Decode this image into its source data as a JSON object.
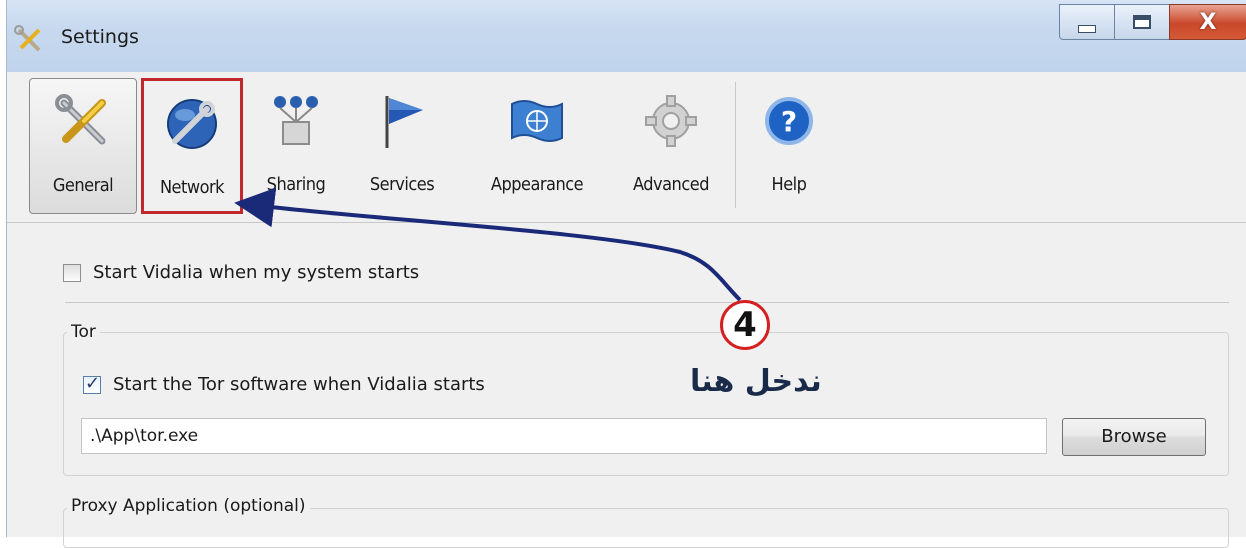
{
  "window": {
    "title": "Settings",
    "icon": "settings-tools-icon"
  },
  "caption_buttons": [
    "minimize-icon",
    "maximize-icon",
    "close-icon"
  ],
  "toolbar": {
    "items": [
      {
        "label": "General",
        "icon": "tools-icon",
        "selected": true
      },
      {
        "label": "Network",
        "icon": "globe-wrench-icon",
        "highlighted": true
      },
      {
        "label": "Sharing",
        "icon": "relay-icon"
      },
      {
        "label": "Services",
        "icon": "flag-icon"
      },
      {
        "label": "Appearance",
        "icon": "un-flag-icon"
      },
      {
        "label": "Advanced",
        "icon": "gear-icon"
      },
      {
        "label": "Help",
        "icon": "help-icon"
      }
    ]
  },
  "general": {
    "start_on_boot_label": "Start Vidalia when my system starts",
    "start_on_boot_checked": false
  },
  "tor_group": {
    "title": "Tor",
    "start_tor_label": "Start the Tor software when Vidalia starts",
    "start_tor_checked": true,
    "path_value": ".\\App\\tor.exe",
    "browse_label": "Browse"
  },
  "proxy_group": {
    "title": "Proxy Application (optional)"
  },
  "annotation": {
    "step_number": "4",
    "text": "ندخل هنا",
    "color": "#d42020",
    "arrow_color": "#1b2a78"
  }
}
